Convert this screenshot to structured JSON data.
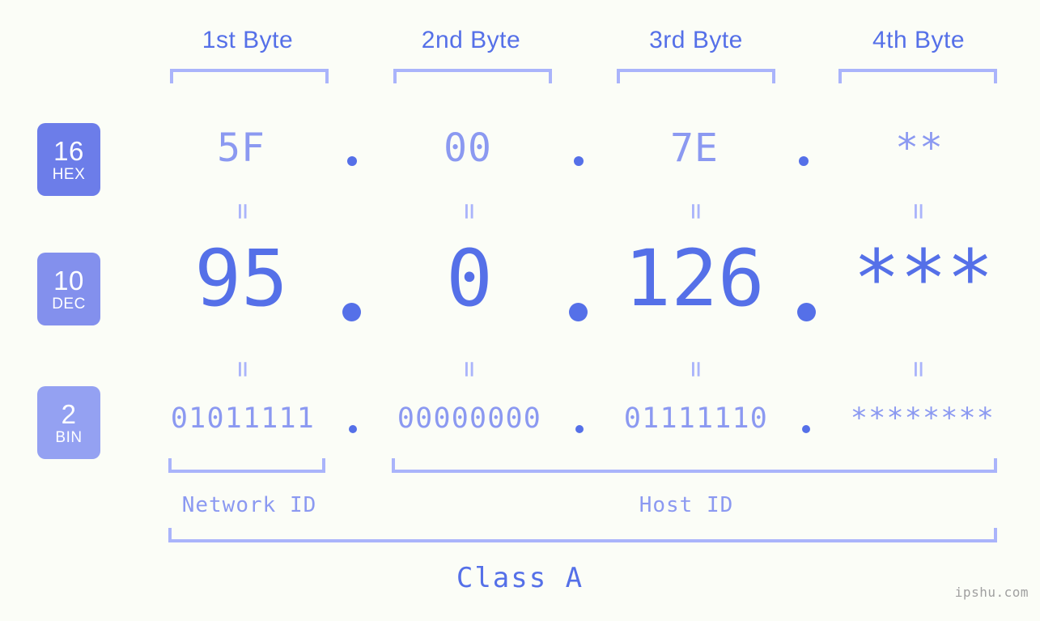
{
  "meta": {
    "background_color": "#fbfdf7",
    "accent_dark": "#5570e8",
    "accent_mid": "#8b99f1",
    "accent_light": "#aab4fb",
    "watermark": "ipshu.com"
  },
  "header": {
    "byte_labels": [
      "1st Byte",
      "2nd Byte",
      "3rd Byte",
      "4th Byte"
    ]
  },
  "bases": [
    {
      "number": "16",
      "name": "HEX",
      "color": "#6c7de9"
    },
    {
      "number": "10",
      "name": "DEC",
      "color": "#8390ed"
    },
    {
      "number": "2",
      "name": "BIN",
      "color": "#94a1f2"
    }
  ],
  "rows": {
    "hex": {
      "values": [
        "5F",
        "00",
        "7E",
        "**"
      ]
    },
    "dec": {
      "values": [
        "95",
        "0",
        "126",
        "***"
      ]
    },
    "bin": {
      "values": [
        "01011111",
        "00000000",
        "01111110",
        "********"
      ]
    }
  },
  "separators": {
    "dot": ".",
    "equals": "=",
    "equals_glyph": "="
  },
  "footer": {
    "network_id_label": "Network ID",
    "host_id_label": "Host ID",
    "class_label": "Class A"
  }
}
